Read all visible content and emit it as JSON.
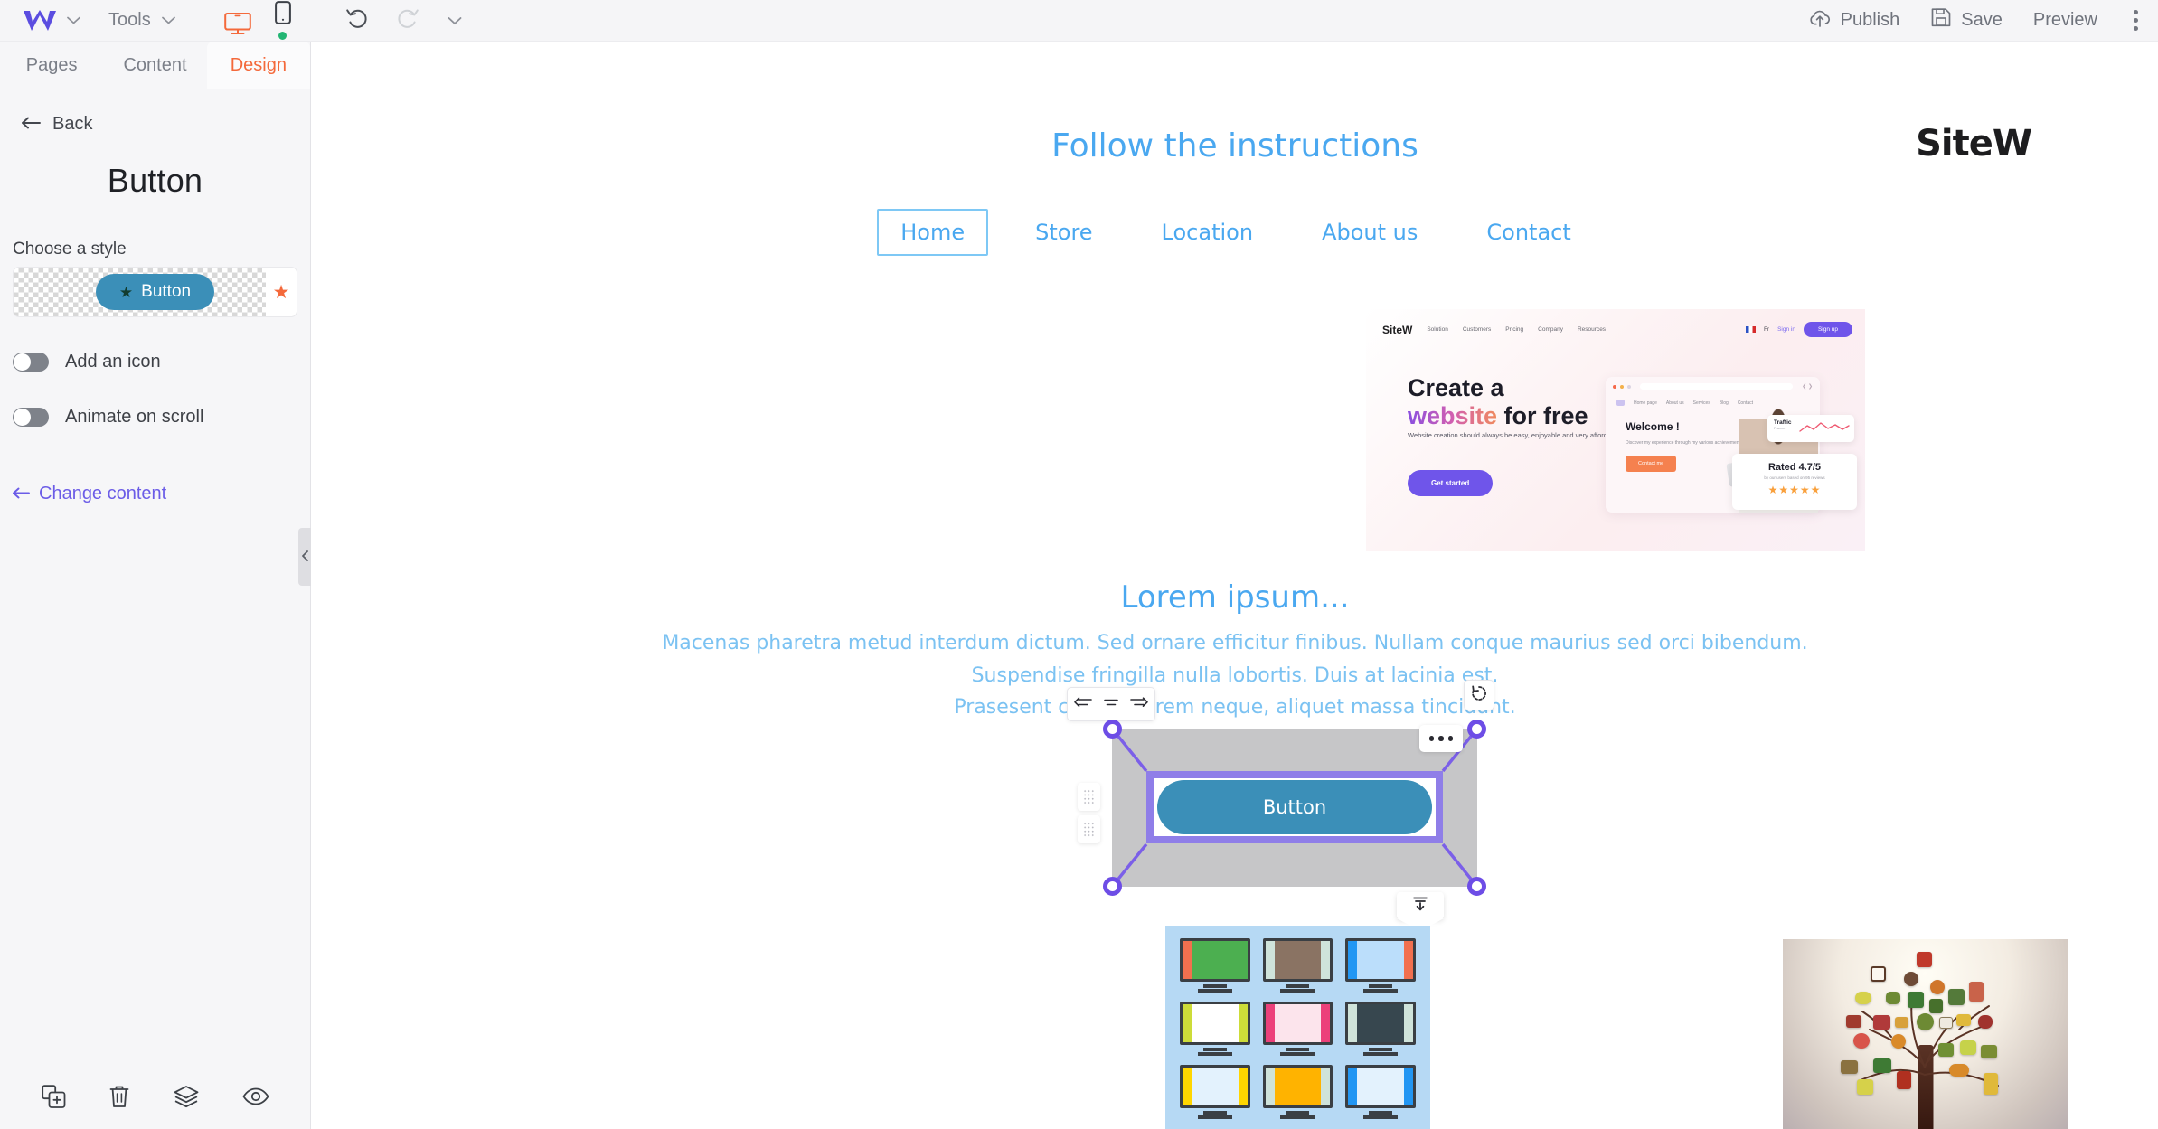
{
  "topbar": {
    "logo": "w-logo",
    "logo_caret": "chevron-down-icon",
    "tools_label": "Tools",
    "device_desktop": "desktop-icon",
    "device_mobile": "mobile-icon",
    "undo": "undo-icon",
    "redo": "redo-icon",
    "history_caret": "chevron-down-icon",
    "publish_label": "Publish",
    "save_label": "Save",
    "preview_label": "Preview",
    "more_label": "kebab-menu",
    "accent_orange": "#f4693b",
    "text_gray": "#6f737c"
  },
  "sidebar": {
    "tabs": [
      {
        "label": "Pages",
        "active": false
      },
      {
        "label": "Content",
        "active": false
      },
      {
        "label": "Design",
        "active": true
      }
    ],
    "back_label": "Back",
    "panel_title": "Button",
    "choose_style_label": "Choose a style",
    "style_preview": {
      "button_label": "Button",
      "star_icon": "star-icon",
      "favorite_icon": "star-favorite-icon",
      "button_color": "#3b8fb8"
    },
    "toggles": [
      {
        "label": "Add an icon",
        "on": false
      },
      {
        "label": "Animate on scroll",
        "on": false
      }
    ],
    "change_content_label": "Change content",
    "collapse_icon": "chevron-left-icon",
    "bottom_tools": [
      {
        "name": "duplicate-icon"
      },
      {
        "name": "trash-icon"
      },
      {
        "name": "layers-icon"
      },
      {
        "name": "eye-icon"
      }
    ]
  },
  "canvas": {
    "site_title": "Follow the instructions",
    "brand_logo": "SiteW",
    "nav": [
      {
        "label": "Home",
        "current": true
      },
      {
        "label": "Store",
        "current": false
      },
      {
        "label": "Location",
        "current": false
      },
      {
        "label": "About us",
        "current": false
      },
      {
        "label": "Contact",
        "current": false
      }
    ],
    "hero": {
      "logo": "SiteW",
      "nav_items": [
        "Solution",
        "Customers",
        "Pricing",
        "Company",
        "Resources"
      ],
      "lang": "Fr",
      "signin": "Sign in",
      "signup": "Sign up",
      "headline_1": "Create a",
      "headline_gradient": "website",
      "headline_2": " for free",
      "paragraph": "Website creation should always be easy, enjoyable and very affordable. Welcome to SiteW.",
      "cta": "Get started",
      "card_nav": [
        "Home page",
        "About us",
        "Services",
        "Blog",
        "Contact"
      ],
      "card_welcome": "Welcome !",
      "card_text": "Discover my experience through my various achievements.",
      "card_button": "Contact me",
      "traffic_title": "Traffic",
      "traffic_sub": "France",
      "rated_title": "Rated 4.7/5",
      "rated_sub": "by our users based on 95 reviews",
      "stars": "★★★★★"
    },
    "lorem_heading": "Lorem ipsum...",
    "lorem_line1": "Macenas pharetra metud interdum dictum. Sed ornare efficitur finibus. Nullam conque maurius sed orci bibendum.",
    "lorem_line2": "Suspendise fringilla nulla lobortis. Duis at lacinia est.",
    "lorem_line3": "Prasesent congue lorem neque, aliquet massa tincidunt.",
    "selection": {
      "button_label": "Button",
      "button_color": "#3b8fb8",
      "border_color": "#8f7ee8",
      "handle_color": "#6d4de6",
      "align_icons": [
        "align-left-icon",
        "align-center-icon",
        "align-right-icon"
      ],
      "rotate_icon": "rotate-reset-icon",
      "more_icon": "ellipsis-icon",
      "grip_icon": "drag-grip-icon",
      "insert_below_icon": "insert-below-icon"
    },
    "images": [
      {
        "name": "monitors-grid-image"
      },
      {
        "name": "social-icon-tree-image"
      }
    ]
  }
}
